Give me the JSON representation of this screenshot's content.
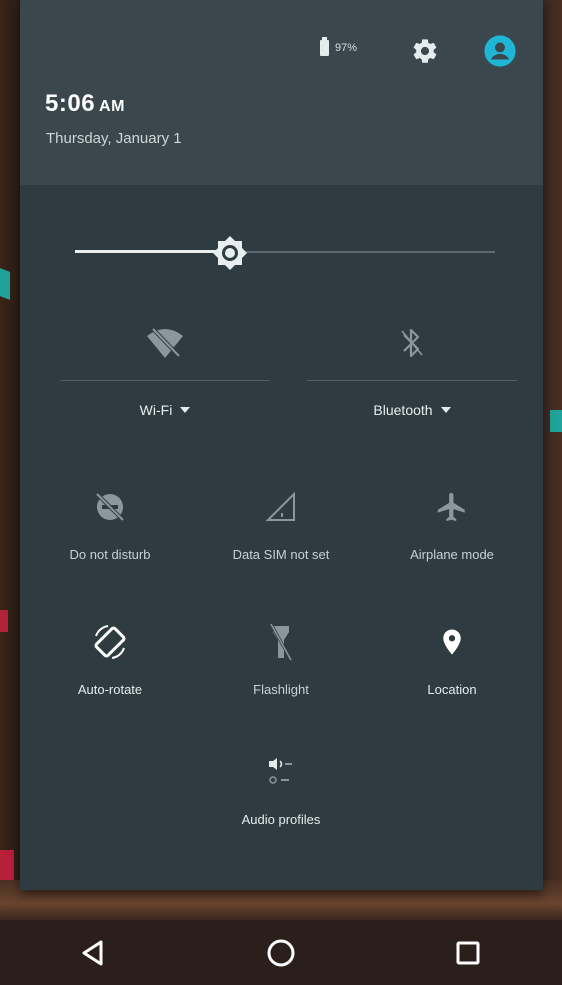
{
  "header": {
    "time": "5:06",
    "ampm": "AM",
    "date": "Thursday, January 1",
    "battery_text": "97%"
  },
  "brightness": {
    "level": 0.37
  },
  "big_tiles": [
    {
      "label": "Wi-Fi",
      "icon": "wifi-off-icon"
    },
    {
      "label": "Bluetooth",
      "icon": "bluetooth-icon"
    }
  ],
  "tiles": [
    {
      "label": "Do not disturb",
      "icon": "do-not-disturb-icon"
    },
    {
      "label": "Data SIM not set",
      "icon": "signal-icon"
    },
    {
      "label": "Airplane mode",
      "icon": "airplane-icon"
    },
    {
      "label": "Auto-rotate",
      "icon": "auto-rotate-icon"
    },
    {
      "label": "Flashlight",
      "icon": "flashlight-icon"
    },
    {
      "label": "Location",
      "icon": "location-icon"
    },
    {
      "label": "Audio profiles",
      "icon": "audio-profiles-icon"
    }
  ],
  "colors": {
    "panel": "#2e3b40",
    "header": "#3a474c",
    "accent": "#1fb6d6",
    "icon_active": "#ffffff",
    "icon_dim": "#8a979b"
  },
  "navbar": {
    "back_icon": "back-triangle-icon",
    "home_icon": "home-circle-icon",
    "recents_icon": "recents-square-icon"
  }
}
